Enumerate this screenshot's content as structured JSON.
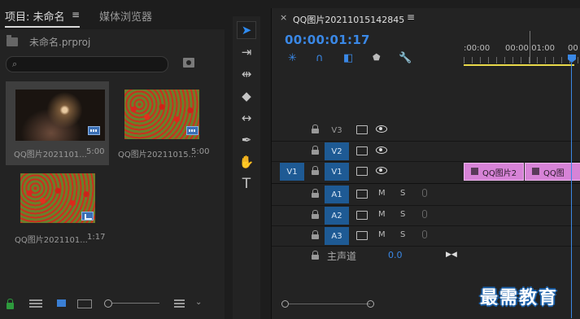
{
  "project_panel": {
    "tab_active": "项目: 未命名",
    "tab_menu": "≡",
    "tab_inactive": "媒体浏览器",
    "project_file": "未命名.prproj",
    "search_value": "",
    "items": [
      {
        "name": "QQ图片2021101...",
        "duration": "5:00",
        "type": "video",
        "selected": true
      },
      {
        "name": "QQ图片20211015...",
        "duration": "5:00",
        "type": "video",
        "selected": false
      },
      {
        "name": "QQ图片2021101...",
        "duration": "1:17",
        "type": "sequence",
        "selected": false
      }
    ]
  },
  "tools": [
    "selection-tool",
    "track-select-tool",
    "ripple-edit-tool",
    "razor-tool",
    "slip-tool",
    "pen-tool",
    "hand-tool",
    "type-tool"
  ],
  "timeline": {
    "close": "×",
    "sequence_name": "QQ图片20211015142845",
    "menu": "≡",
    "timecode": "00:00:01:17",
    "ruler_labels": [
      ":00:00",
      "00:00:01:00",
      "00"
    ],
    "video_tracks": [
      {
        "label": "V3",
        "targeted": false
      },
      {
        "label": "V2",
        "targeted": true
      },
      {
        "label": "V1",
        "targeted": true,
        "source": "V1"
      }
    ],
    "audio_tracks": [
      {
        "label": "A1",
        "m": "M",
        "s": "S"
      },
      {
        "label": "A2",
        "m": "M",
        "s": "S"
      },
      {
        "label": "A3",
        "m": "M",
        "s": "S"
      }
    ],
    "master_label": "主声道",
    "master_value": "0.0",
    "clips": [
      {
        "label": "QQ图片2"
      },
      {
        "label": "QQ图"
      }
    ]
  },
  "watermark": "最需教育",
  "colors": {
    "accent": "#3a88e6",
    "clip": "#d783d7",
    "track_target": "#1e5a94",
    "work_area": "#e9d94a"
  }
}
